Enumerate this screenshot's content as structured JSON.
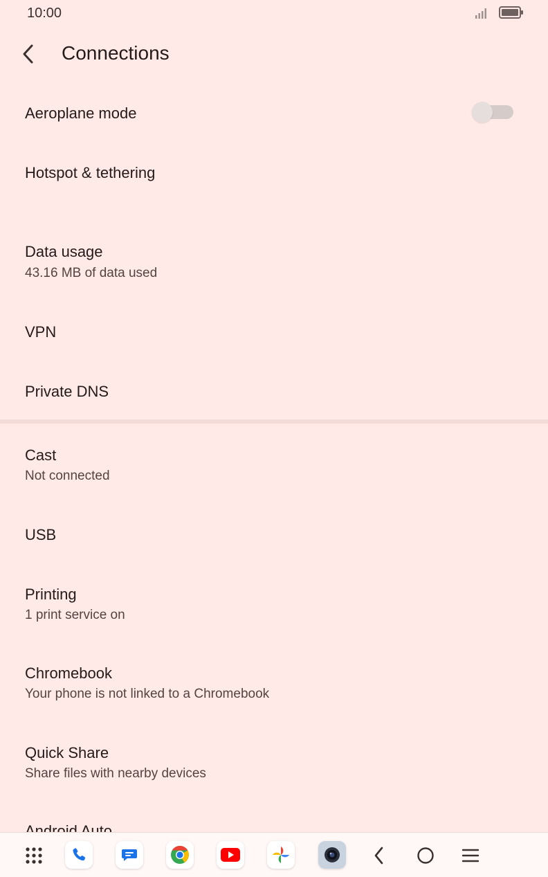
{
  "status_bar": {
    "time": "10:00",
    "icons": [
      "signal-icon",
      "battery-icon"
    ]
  },
  "app_bar": {
    "back_icon": "arrow-back-icon",
    "title": "Connections"
  },
  "items": [
    {
      "title": "Aeroplane mode",
      "toggle_on": false
    },
    {
      "title": "Hotspot & tethering"
    },
    {
      "title": "Data usage",
      "summary": "43.16 MB of data used"
    },
    {
      "title": "VPN"
    },
    {
      "title": "Private DNS"
    },
    {
      "title": "Cast",
      "summary": "Not connected"
    },
    {
      "title": "USB"
    },
    {
      "title": "Printing",
      "summary": "1 print service on"
    },
    {
      "title": "Chromebook",
      "summary": "Your phone is not linked to a Chromebook"
    },
    {
      "title": "Quick Share",
      "summary": "Share files with nearby devices"
    },
    {
      "title": "Android Auto"
    }
  ],
  "nav_bar": {
    "apps": [
      "app-drawer-icon",
      "phone-icon",
      "messages-icon",
      "chrome-icon",
      "youtube-icon",
      "photos-icon",
      "camera-icon"
    ],
    "buttons": [
      "back-icon",
      "home-icon",
      "recents-icon"
    ]
  },
  "colors": {
    "background": "#FFEAE7",
    "text": "#231A19",
    "summary_text": "#534341",
    "divider": "#F3DCD8"
  }
}
